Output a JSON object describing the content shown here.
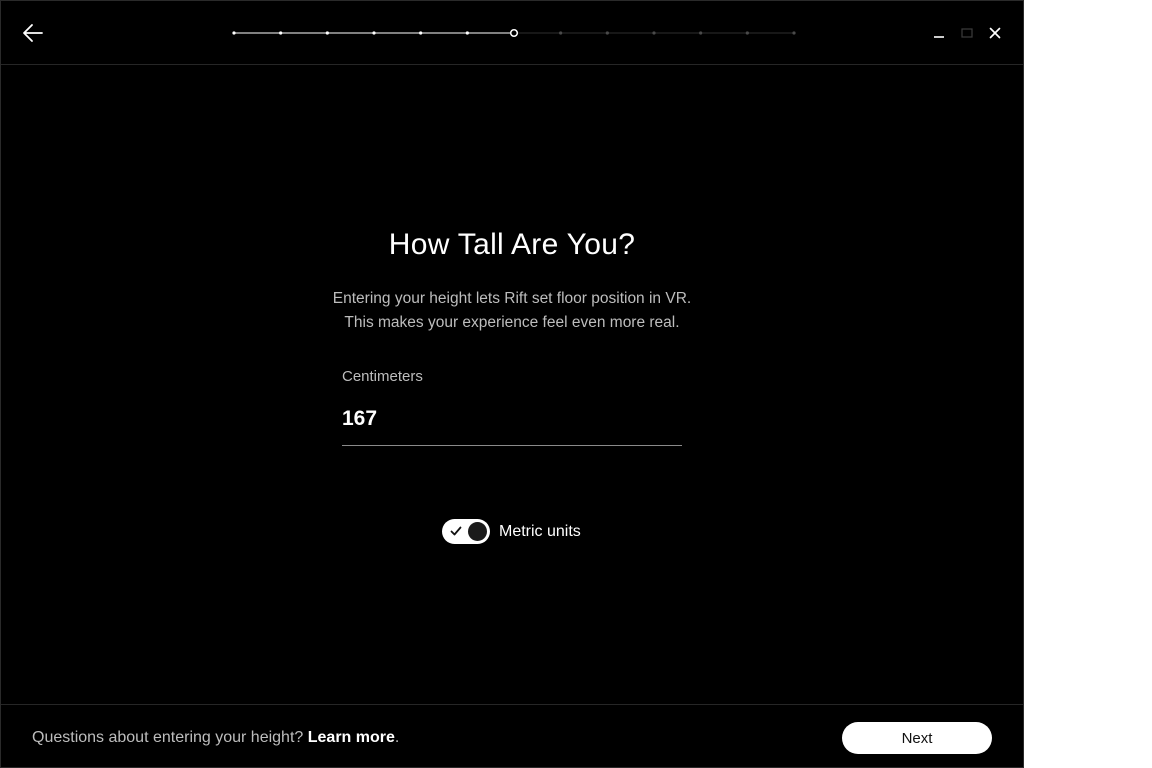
{
  "header": {
    "back_icon": "arrow-left-icon",
    "progress": {
      "total_steps": 13,
      "completed_steps": 6,
      "current_step": 7
    },
    "window_controls": {
      "minimize_icon": "minimize-icon",
      "maximize_icon": "maximize-icon",
      "close_icon": "close-icon"
    }
  },
  "main": {
    "title": "How Tall Are You?",
    "description_line1": "Entering your height lets Rift set floor position in VR.",
    "description_line2": "This makes your experience feel even more real.",
    "height_field": {
      "label": "Centimeters",
      "value": "167"
    },
    "metric_toggle": {
      "label": "Metric units",
      "checked": true
    }
  },
  "footer": {
    "question_text": "Questions about entering your height? ",
    "learn_more_label": "Learn more",
    "period": ".",
    "next_label": "Next"
  },
  "colors": {
    "background": "#000000",
    "text_primary": "#ffffff",
    "text_secondary": "#bdbdbd",
    "button_background": "#ffffff"
  }
}
